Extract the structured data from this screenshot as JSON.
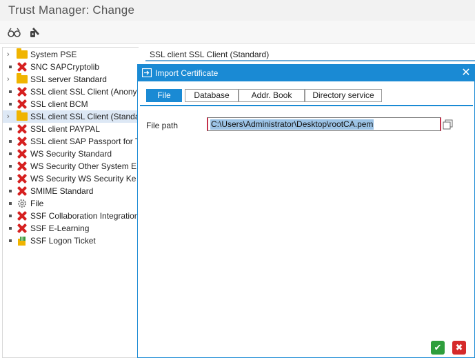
{
  "window": {
    "title": "Trust Manager: Change"
  },
  "toolbar": {
    "buttons": [
      {
        "icon": "glasses-icon"
      },
      {
        "icon": "pencil-key-icon"
      }
    ]
  },
  "tree": {
    "items": [
      {
        "label": "System PSE",
        "icon": "folder-icon",
        "expander": "›"
      },
      {
        "label": "SNC SAPCryptolib",
        "icon": "error-x-icon"
      },
      {
        "label": "SSL server Standard",
        "icon": "folder-icon",
        "expander": "›"
      },
      {
        "label": "SSL client SSL Client (Anony",
        "icon": "error-x-icon"
      },
      {
        "label": "SSL client BCM",
        "icon": "error-x-icon"
      },
      {
        "label": "SSL client SSL Client (Standa",
        "icon": "folder-icon",
        "expander": "›",
        "selected": true
      },
      {
        "label": "SSL client PAYPAL",
        "icon": "error-x-icon"
      },
      {
        "label": "SSL client SAP Passport for T",
        "icon": "error-x-icon"
      },
      {
        "label": "WS Security Standard",
        "icon": "error-x-icon"
      },
      {
        "label": "WS Security Other System E",
        "icon": "error-x-icon"
      },
      {
        "label": "WS Security WS Security Ke",
        "icon": "error-x-icon"
      },
      {
        "label": "SMIME Standard",
        "icon": "error-x-icon"
      },
      {
        "label": "File",
        "icon": "gear-icon"
      },
      {
        "label": "SSF Collaboration Integration",
        "icon": "error-x-icon"
      },
      {
        "label": "SSF E-Learning",
        "icon": "error-x-icon"
      },
      {
        "label": "SSF Logon Ticket",
        "icon": "ticket-icon"
      }
    ]
  },
  "right_panel": {
    "field_value": "SSL client SSL Client (Standard)"
  },
  "dialog": {
    "title": "Import Certificate",
    "close_glyph": "✕",
    "tabs": [
      {
        "label": "File",
        "active": true
      },
      {
        "label": "Database"
      },
      {
        "label": "Addr. Book"
      },
      {
        "label": "Directory service"
      }
    ],
    "file_path_label": "File path",
    "file_path_value": "C:\\Users\\Administrator\\Desktop\\rootCA.pem",
    "ok_glyph": "✔",
    "cancel_glyph": "✖"
  },
  "colors": {
    "accent": "#1a8ad4",
    "error": "#d62020",
    "ok": "#2e9e3c",
    "cancel": "#d62a2a",
    "selection": "#9cc3e6"
  }
}
